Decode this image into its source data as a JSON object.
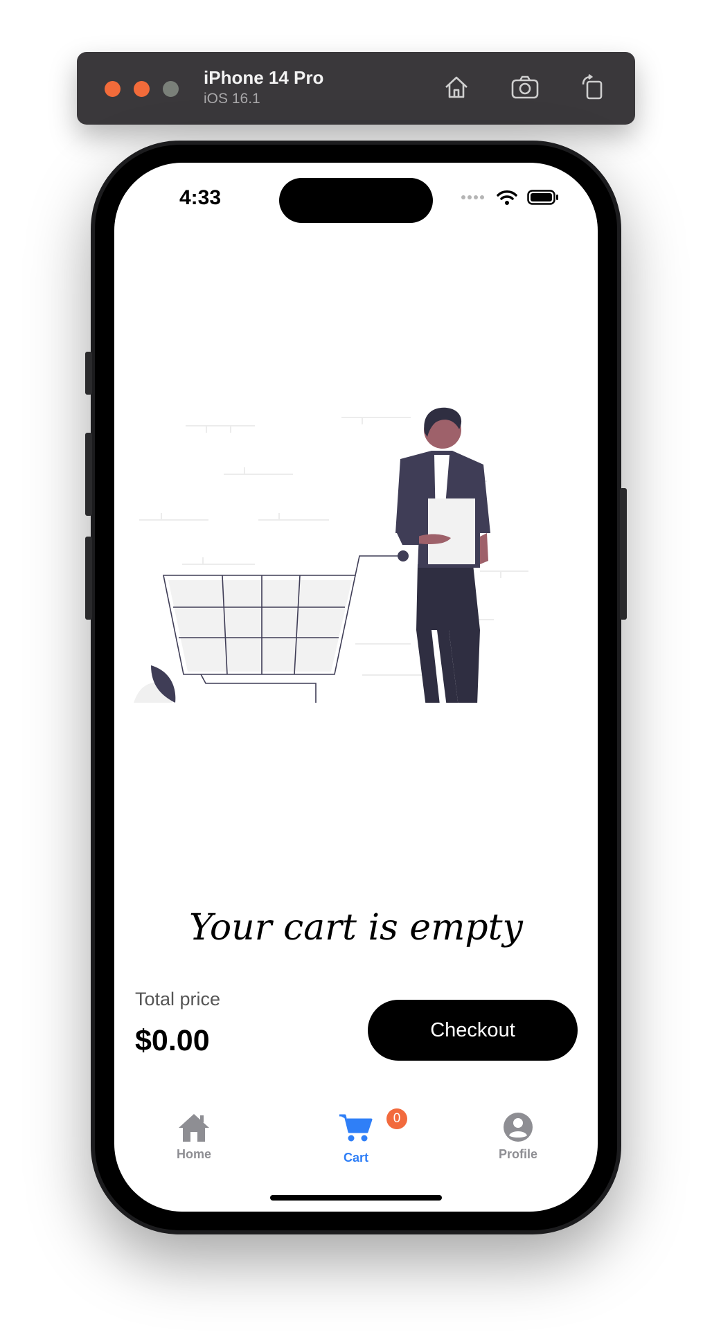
{
  "simulator": {
    "device_name": "iPhone 14 Pro",
    "os_version": "iOS 16.1",
    "controls": [
      "home-icon",
      "screenshot-icon",
      "rotate-icon"
    ],
    "traffic_lights": [
      "#f26b3a",
      "#f26b3a",
      "#7a8079"
    ]
  },
  "status_bar": {
    "time": "4:33",
    "icons": [
      "cellular-icon",
      "wifi-icon",
      "battery-icon"
    ]
  },
  "cart": {
    "empty_message": "Your cart is empty",
    "total_label": "Total price",
    "total_value": "$0.00",
    "checkout_label": "Checkout"
  },
  "tab_bar": {
    "active": "Cart",
    "active_color": "#2f7ff7",
    "inactive_color": "#8e8e93",
    "items": [
      {
        "label": "Home",
        "icon": "home-icon"
      },
      {
        "label": "Cart",
        "icon": "cart-icon",
        "badge": "0"
      },
      {
        "label": "Profile",
        "icon": "profile-icon"
      }
    ]
  },
  "colors": {
    "badge": "#f26a3d",
    "checkout_bg": "#000000",
    "illustration_figure": "#3f3d56",
    "illustration_skin": "#9e616a"
  }
}
